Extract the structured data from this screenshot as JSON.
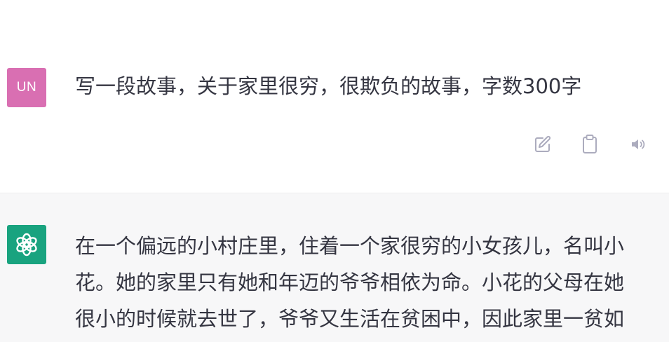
{
  "user_message": {
    "avatar_initials": "UN",
    "text": "写一段故事，关于家里很穷，很欺负的故事，字数300字",
    "actions": [
      "edit-icon",
      "clipboard-icon",
      "speaker-icon"
    ]
  },
  "assistant_message": {
    "avatar_icon": "openai-logo-icon",
    "lines": [
      "在一个偏远的小村庄里，住着一个家很穷的小女孩儿，名叫小",
      "花。她的家里只有她和年迈的爷爷相依为命。小花的父母在她",
      "很小的时候就去世了，爷爷又生活在贫困中，因此家里一贫如"
    ]
  },
  "colors": {
    "user_avatar_bg": "#d96fb2",
    "assistant_avatar_bg": "#19a37f",
    "assistant_block_bg": "#f7f7f8",
    "text": "#343541",
    "icon": "#acacbe"
  }
}
